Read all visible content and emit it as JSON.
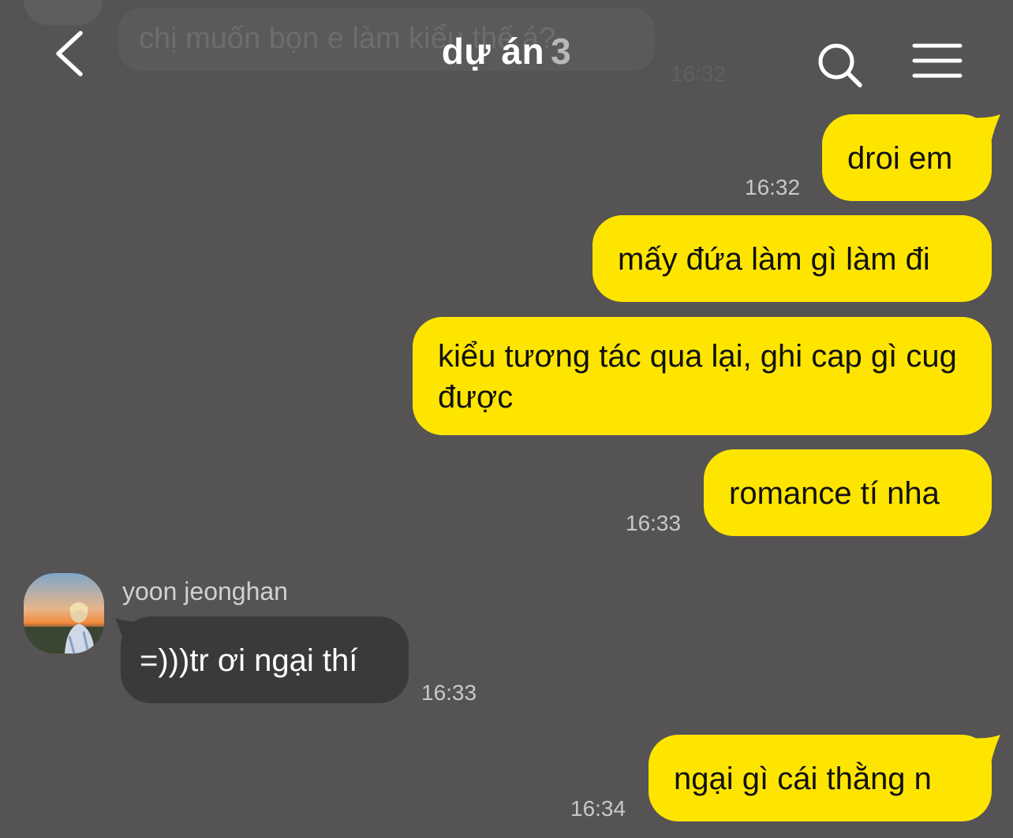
{
  "header": {
    "title": "dự án",
    "member_count": "3",
    "back_icon": "chevron-left-icon",
    "search_icon": "search-icon",
    "menu_icon": "hamburger-menu-icon"
  },
  "previous_message": {
    "text": "chị muốn bọn e làm kiểu thế á?",
    "time": "16:32"
  },
  "messages": [
    {
      "from": "me",
      "text": "droi em",
      "time": "16:32"
    },
    {
      "from": "me",
      "text": "mấy đứa làm gì làm đi",
      "time": ""
    },
    {
      "from": "me",
      "text": "kiểu tương tác qua lại, ghi cap gì cug được",
      "time": ""
    },
    {
      "from": "me",
      "text": "romance tí nha",
      "time": "16:33"
    },
    {
      "from": "them",
      "sender": "yoon jeonghan",
      "text": "=)))tr ơi ngại thí",
      "time": "16:33"
    },
    {
      "from": "me",
      "text": "ngại gì cái thằng n",
      "time": "16:34"
    }
  ],
  "colors": {
    "background": "#555354",
    "my_bubble": "#fee500",
    "their_bubble": "#3b3a3b"
  }
}
